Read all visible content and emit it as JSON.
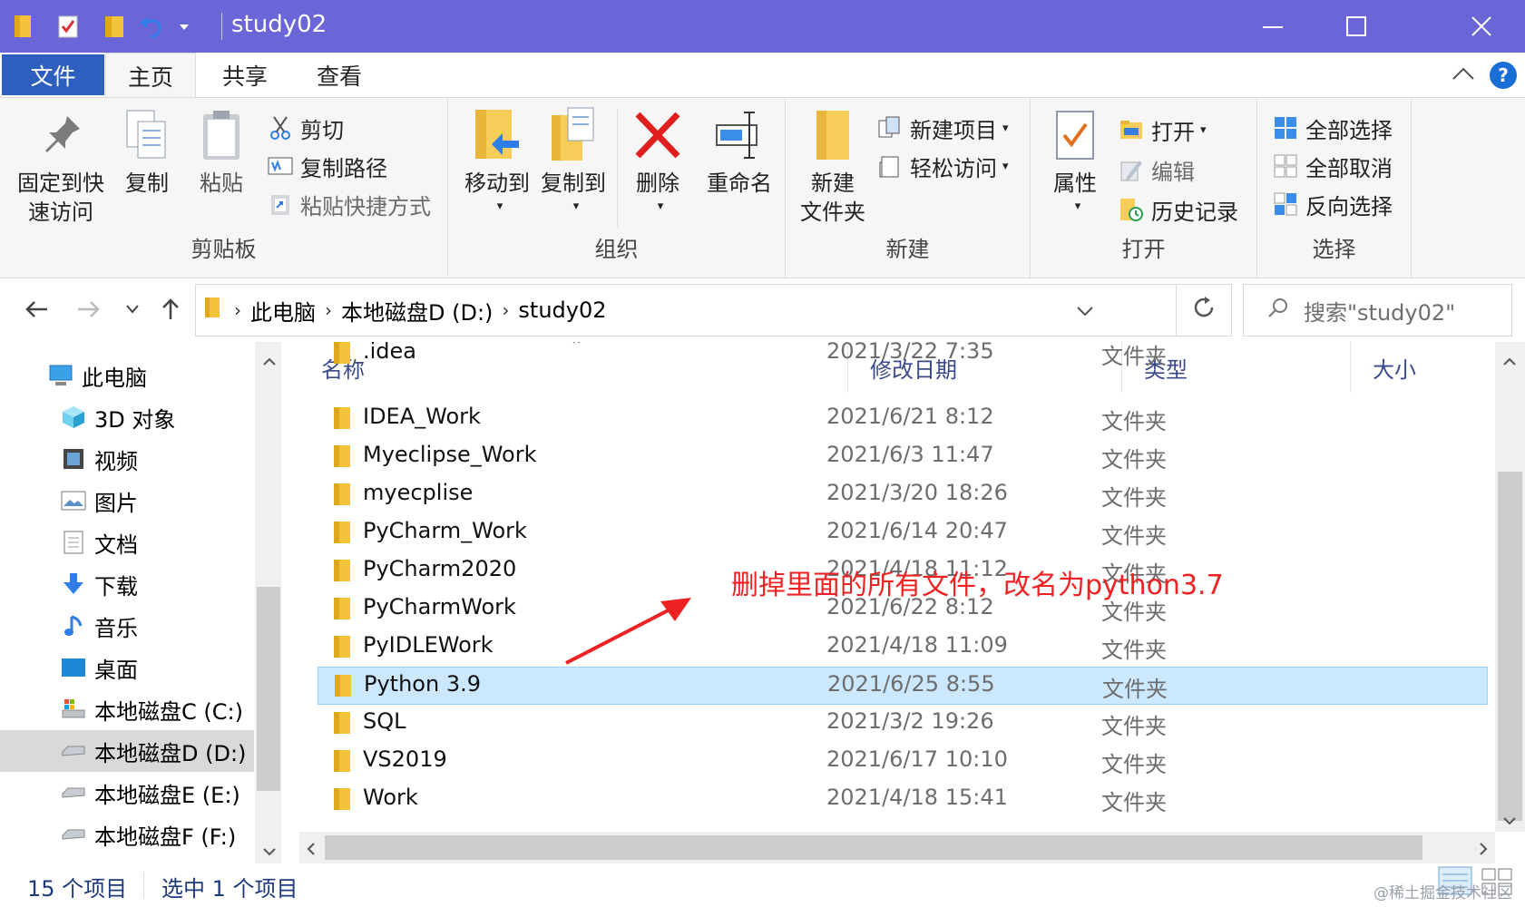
{
  "window": {
    "title": "study02",
    "colors": {
      "titlebar": "#6b66d8",
      "file_tab": "#2e5fbf",
      "selection": "#cce8ff",
      "annotation": "#ee2222"
    }
  },
  "tabs": {
    "file": "文件",
    "home": "主页",
    "share": "共享",
    "view": "查看",
    "help": "?"
  },
  "ribbon": {
    "clipboard": {
      "pin_line1": "固定到快",
      "pin_line2": "速访问",
      "copy": "复制",
      "paste": "粘贴",
      "cut": "剪切",
      "copy_path": "复制路径",
      "paste_shortcut": "粘贴快捷方式",
      "label": "剪贴板"
    },
    "organize": {
      "move_to": "移动到",
      "copy_to": "复制到",
      "delete": "删除",
      "rename": "重命名",
      "label": "组织"
    },
    "new": {
      "new_folder_line1": "新建",
      "new_folder_line2": "文件夹",
      "new_item": "新建项目",
      "easy_access": "轻松访问",
      "label": "新建"
    },
    "open": {
      "properties": "属性",
      "open": "打开",
      "edit": "编辑",
      "history": "历史记录",
      "label": "打开"
    },
    "select": {
      "select_all": "全部选择",
      "select_none": "全部取消",
      "invert": "反向选择",
      "label": "选择"
    }
  },
  "address": {
    "crumbs": [
      "此电脑",
      "本地磁盘D (D:)",
      "study02"
    ],
    "search_placeholder": "搜索\"study02\""
  },
  "nav": {
    "items": [
      {
        "label": "此电脑",
        "icon": "pc-icon"
      },
      {
        "label": "3D 对象",
        "icon": "cube-icon"
      },
      {
        "label": "视频",
        "icon": "video-icon"
      },
      {
        "label": "图片",
        "icon": "picture-icon"
      },
      {
        "label": "文档",
        "icon": "document-icon"
      },
      {
        "label": "下载",
        "icon": "download-icon"
      },
      {
        "label": "音乐",
        "icon": "music-icon"
      },
      {
        "label": "桌面",
        "icon": "desktop-icon"
      },
      {
        "label": "本地磁盘C (C:)",
        "icon": "drive-c-icon"
      },
      {
        "label": "本地磁盘D (D:)",
        "icon": "drive-icon"
      },
      {
        "label": "本地磁盘E (E:)",
        "icon": "drive-icon"
      },
      {
        "label": "本地磁盘F (F:)",
        "icon": "drive-icon"
      }
    ]
  },
  "columns": {
    "name": "名称",
    "date": "修改日期",
    "type": "类型",
    "size": "大小"
  },
  "files": [
    {
      "name": ".idea",
      "date": "2021/3/22 7:35",
      "type": "文件夹"
    },
    {
      "name": "IDEA_Work",
      "date": "2021/6/21 8:12",
      "type": "文件夹"
    },
    {
      "name": "Myeclipse_Work",
      "date": "2021/6/3 11:47",
      "type": "文件夹"
    },
    {
      "name": "myecplise",
      "date": "2021/3/20 18:26",
      "type": "文件夹"
    },
    {
      "name": "PyCharm_Work",
      "date": "2021/6/14 20:47",
      "type": "文件夹"
    },
    {
      "name": "PyCharm2020",
      "date": "2021/4/18 11:12",
      "type": "文件夹"
    },
    {
      "name": "PyCharmWork",
      "date": "2021/6/22 8:12",
      "type": "文件夹"
    },
    {
      "name": "PyIDLEWork",
      "date": "2021/4/18 11:09",
      "type": "文件夹"
    },
    {
      "name": "Python 3.9",
      "date": "2021/6/25 8:55",
      "type": "文件夹",
      "selected": true
    },
    {
      "name": "SQL",
      "date": "2021/3/2 19:26",
      "type": "文件夹"
    },
    {
      "name": "VS2019",
      "date": "2021/6/17 10:10",
      "type": "文件夹"
    },
    {
      "name": "Work",
      "date": "2021/4/18 15:41",
      "type": "文件夹"
    }
  ],
  "annotation": "删掉里面的所有文件，改名为python3.7",
  "status": {
    "count": "15 个项目",
    "selected": "选中 1 个项目"
  },
  "watermark": "@稀土掘金技术社区"
}
